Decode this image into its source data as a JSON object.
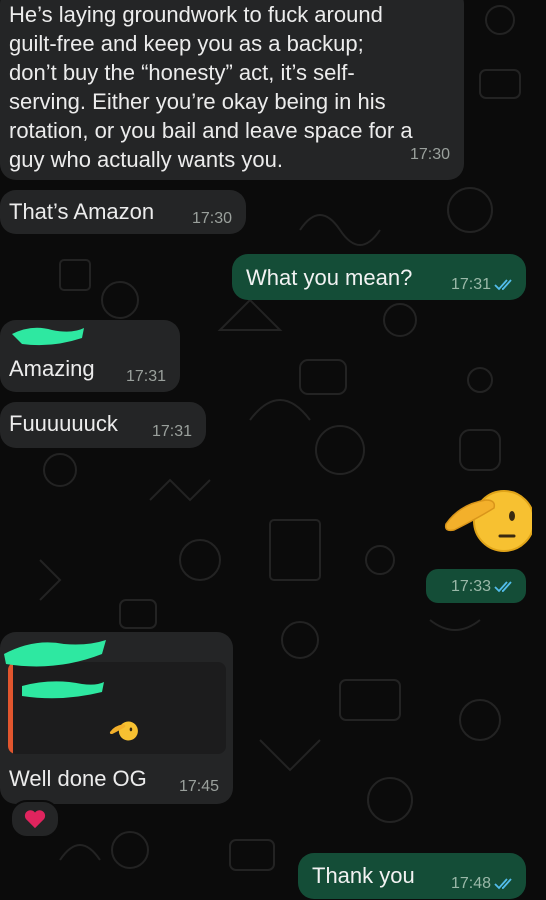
{
  "chat": {
    "messages": [
      {
        "id": "m1",
        "direction": "incoming",
        "lines": [
          "He’s laying groundwork to fuck around",
          "guilt-free and keep you as a backup;",
          "don’t buy the “honesty” act, it’s self-",
          "serving. Either you’re okay being in his",
          "rotation, or you bail and leave space for a",
          "guy who actually wants you."
        ],
        "time": "17:30"
      },
      {
        "id": "m2",
        "direction": "incoming",
        "text": "That’s Amazon",
        "time": "17:30"
      },
      {
        "id": "m3",
        "direction": "outgoing",
        "text": "What you mean?",
        "time": "17:31",
        "status": "read"
      },
      {
        "id": "m4",
        "direction": "incoming",
        "sender": "redacted",
        "text": "Amazing",
        "time": "17:31"
      },
      {
        "id": "m5",
        "direction": "incoming",
        "text": "Fuuuuuuck",
        "time": "17:31"
      },
      {
        "id": "m6",
        "direction": "outgoing",
        "type": "emoji",
        "emoji": "saluting-face",
        "time": "17:33",
        "status": "read"
      },
      {
        "id": "m7",
        "direction": "incoming",
        "sender": "redacted",
        "quoted_emoji": "saluting-face",
        "text": "Well done OG",
        "time": "17:45",
        "reaction": "heart"
      },
      {
        "id": "m8",
        "direction": "outgoing",
        "text": "Thank you",
        "time": "17:48",
        "status": "read"
      }
    ]
  },
  "colors": {
    "background": "#0b0b0b",
    "incoming_bubble": "#242526",
    "outgoing_bubble": "#144d37",
    "read_ticks": "#53bdeb",
    "redaction": "#2ee8a1",
    "reply_bar": "#e1562e",
    "heart": "#e0245e"
  },
  "icons": {
    "read_receipt": "double-check-icon",
    "reaction": "heart-icon",
    "emoji": "saluting-face-emoji"
  }
}
